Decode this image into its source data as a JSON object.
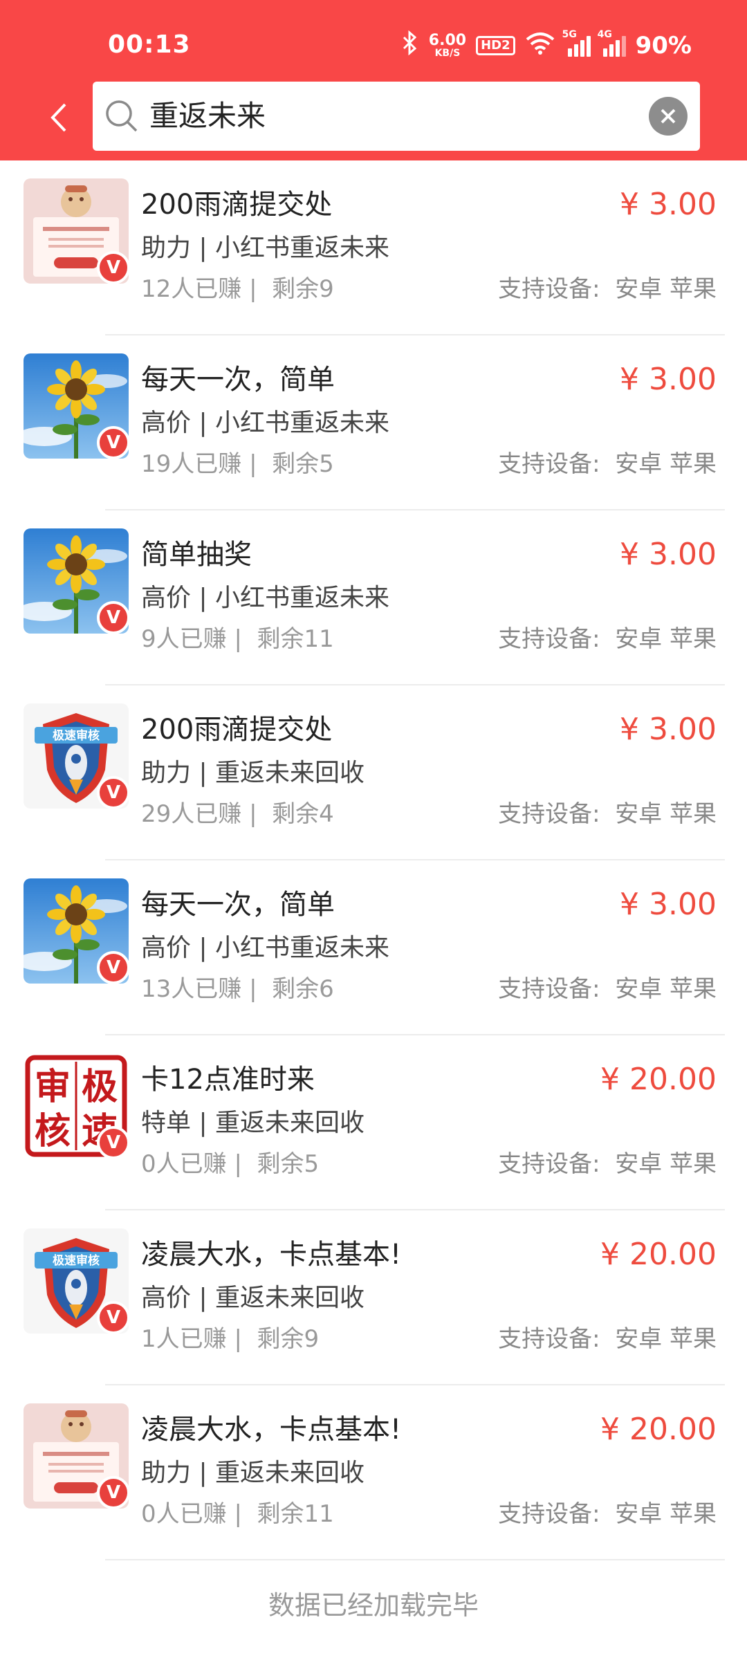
{
  "status_bar": {
    "time": "00:13",
    "net_speed_value": "6.00",
    "net_speed_unit": "KB/S",
    "hd_badge": "HD2",
    "signal_1_label": "5G",
    "signal_2_label": "4G",
    "battery": "90%"
  },
  "search": {
    "query": "重返未来"
  },
  "items": [
    {
      "title": "200雨滴提交处",
      "subtitle": "助力 | 小红书重返未来",
      "earned": "12人已赚 |",
      "remaining": "剩余9",
      "price": "¥ 3.00",
      "device_label": "支持设备:",
      "devices": "安卓 苹果",
      "thumb": "doc-thumb"
    },
    {
      "title": "每天一次，简单",
      "subtitle": "高价 | 小红书重返未来",
      "earned": "19人已赚 |",
      "remaining": "剩余5",
      "price": "¥ 3.00",
      "device_label": "支持设备:",
      "devices": "安卓 苹果",
      "thumb": "sunflower-thumb"
    },
    {
      "title": "简单抽奖",
      "subtitle": "高价 | 小红书重返未来",
      "earned": "9人已赚 |",
      "remaining": "剩余11",
      "price": "¥ 3.00",
      "device_label": "支持设备:",
      "devices": "安卓 苹果",
      "thumb": "sunflower-thumb"
    },
    {
      "title": "200雨滴提交处",
      "subtitle": "助力 | 重返未来回收",
      "earned": "29人已赚 |",
      "remaining": "剩余4",
      "price": "¥ 3.00",
      "device_label": "支持设备:",
      "devices": "安卓 苹果",
      "thumb": "shield-thumb"
    },
    {
      "title": "每天一次，简单",
      "subtitle": "高价 | 小红书重返未来",
      "earned": "13人已赚 |",
      "remaining": "剩余6",
      "price": "¥ 3.00",
      "device_label": "支持设备:",
      "devices": "安卓 苹果",
      "thumb": "sunflower-thumb"
    },
    {
      "title": "卡12点准时来",
      "subtitle": "特单 | 重返未来回收",
      "earned": "0人已赚 |",
      "remaining": "剩余5",
      "price": "¥ 20.00",
      "device_label": "支持设备:",
      "devices": "安卓 苹果",
      "thumb": "stamp-thumb"
    },
    {
      "title": "凌晨大水，卡点基本!",
      "subtitle": "高价 | 重返未来回收",
      "earned": "1人已赚 |",
      "remaining": "剩余9",
      "price": "¥ 20.00",
      "device_label": "支持设备:",
      "devices": "安卓 苹果",
      "thumb": "shield-thumb"
    },
    {
      "title": "凌晨大水，卡点基本!",
      "subtitle": "助力 | 重返未来回收",
      "earned": "0人已赚 |",
      "remaining": "剩余11",
      "price": "¥ 20.00",
      "device_label": "支持设备:",
      "devices": "安卓 苹果",
      "thumb": "doc-thumb"
    }
  ],
  "thumb_text": {
    "shield_banner": "极速审核",
    "stamp_chars": [
      "审",
      "极",
      "核",
      "速"
    ]
  },
  "badge_letter": "V",
  "footer": "数据已经加载完毕",
  "colors": {
    "header_bg": "#f94747",
    "price": "#ee4b3e",
    "badge": "#e8403c"
  }
}
